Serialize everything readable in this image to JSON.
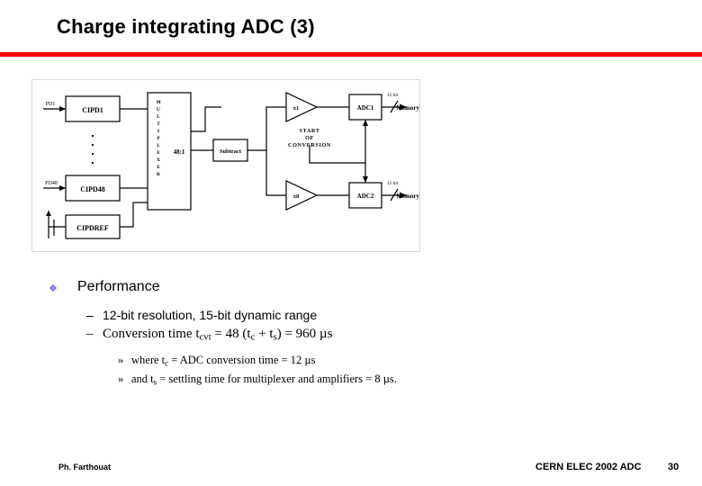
{
  "slide": {
    "title": "Charge integrating ADC (3)",
    "accent_color": "#ff0000"
  },
  "diagram": {
    "name": "charge-integrating-adc-block-diagram",
    "labels": {
      "input_top": "PD1",
      "input_bottom": "PD48",
      "block_top": "CIPD1",
      "block_bottom": "CIPD48",
      "block_ref": "CIPDREF",
      "mux": "M U L T I P L E X E R",
      "mux_ratio": "48:1",
      "subtract": "Subtract",
      "amp_top": "x1",
      "amp_bottom": "x8",
      "adc_top": "ADC1",
      "adc_bottom": "ADC2",
      "bits_top": "12 bit",
      "bits_bottom": "12 bit",
      "memory_top": "Memory",
      "memory_bottom": "Memory",
      "start_conv": "START OF CONVERSION"
    }
  },
  "content": {
    "level1": {
      "marker": "❖",
      "text": "Performance"
    },
    "level2": [
      {
        "marker": "–",
        "html": "12-bit resolution, 15-bit dynamic range",
        "serif": false
      },
      {
        "marker": "–",
        "html": "Conversion time t<sub>cvt</sub> = 48 (t<sub>c</sub> + t<sub>s</sub>) = 960 µs",
        "serif": true
      }
    ],
    "level3": [
      {
        "marker": "»",
        "html": "where t<sub>c</sub> = ADC conversion time = 12 µs"
      },
      {
        "marker": "»",
        "html": "and t<sub>s</sub> = settling time for multiplexer and amplifiers = 8 µs."
      }
    ]
  },
  "footer": {
    "author": "Ph. Farthouat",
    "center": "CERN ELEC 2002 ADC",
    "page": "30"
  }
}
